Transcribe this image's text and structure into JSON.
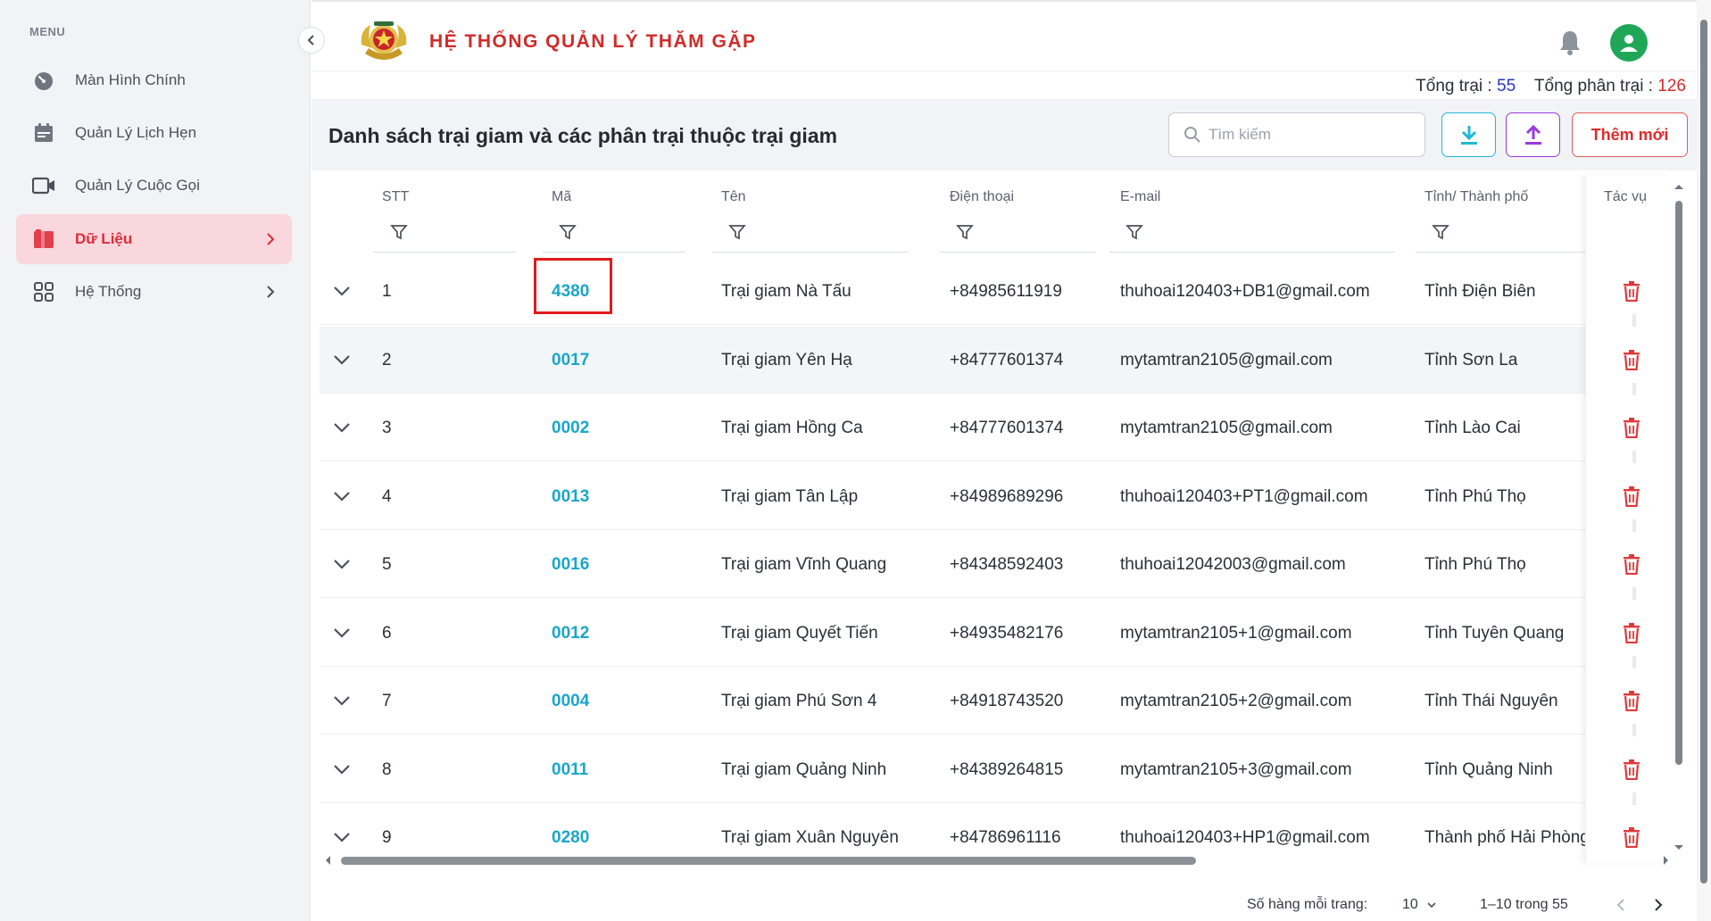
{
  "sidebar": {
    "menu_title": "MENU",
    "items": [
      {
        "label": "Màn Hình Chính",
        "icon": "dashboard-gauge-icon"
      },
      {
        "label": "Quản Lý Lịch Hẹn",
        "icon": "calendar-icon"
      },
      {
        "label": "Quản Lý Cuộc Gọi",
        "icon": "video-camera-icon"
      },
      {
        "label": "Dữ Liệu",
        "icon": "database-folder-icon",
        "active": true
      },
      {
        "label": "Hệ Thống",
        "icon": "grid-apps-icon"
      }
    ]
  },
  "header": {
    "title": "HỆ THỐNG QUẢN LÝ THĂM GẶP",
    "logo": "police-emblem-logo"
  },
  "totals": {
    "camps_label": "Tổng trại :",
    "camps_value": "55",
    "subcamps_label": "Tổng phân trại :",
    "subcamps_value": "126"
  },
  "toolbar": {
    "title": "Danh sách trại giam và các phân trại thuộc trại giam",
    "search_placeholder": "Tìm kiếm",
    "add_label": "Thêm mới"
  },
  "table": {
    "columns": [
      "STT",
      "Mã",
      "Tên",
      "Điện thoại",
      "E-mail",
      "Tỉnh/ Thành phố",
      "Tác vụ"
    ],
    "rows": [
      {
        "stt": "1",
        "code": "4380",
        "name": "Trại giam Nà Tấu",
        "phone": "+84985611919",
        "email": "thuhoai120403+DB1@gmail.com",
        "province": "Tỉnh Điện Biên"
      },
      {
        "stt": "2",
        "code": "0017",
        "name": "Trại giam Yên Hạ",
        "phone": "+84777601374",
        "email": "mytamtran2105@gmail.com",
        "province": "Tỉnh Sơn La"
      },
      {
        "stt": "3",
        "code": "0002",
        "name": "Trại giam Hồng Ca",
        "phone": "+84777601374",
        "email": "mytamtran2105@gmail.com",
        "province": "Tỉnh Lào Cai"
      },
      {
        "stt": "4",
        "code": "0013",
        "name": "Trại giam Tân Lập",
        "phone": "+84989689296",
        "email": "thuhoai120403+PT1@gmail.com",
        "province": "Tỉnh Phú Thọ"
      },
      {
        "stt": "5",
        "code": "0016",
        "name": "Trại giam Vĩnh Quang",
        "phone": "+84348592403",
        "email": "thuhoai12042003@gmail.com",
        "province": "Tỉnh Phú Thọ"
      },
      {
        "stt": "6",
        "code": "0012",
        "name": "Trại giam Quyết Tiến",
        "phone": "+84935482176",
        "email": "mytamtran2105+1@gmail.com",
        "province": "Tỉnh Tuyên Quang"
      },
      {
        "stt": "7",
        "code": "0004",
        "name": "Trại giam Phú Sơn 4",
        "phone": "+84918743520",
        "email": "mytamtran2105+2@gmail.com",
        "province": "Tỉnh Thái Nguyên"
      },
      {
        "stt": "8",
        "code": "0011",
        "name": "Trại giam Quảng Ninh",
        "phone": "+84389264815",
        "email": "mytamtran2105+3@gmail.com",
        "province": "Tỉnh Quảng Ninh"
      },
      {
        "stt": "9",
        "code": "0280",
        "name": "Trại giam Xuân Nguyên",
        "phone": "+84786961116",
        "email": "thuhoai120403+HP1@gmail.com",
        "province": "Thành phố Hải Phòng"
      }
    ]
  },
  "pagination": {
    "rows_per_page_label": "Số hàng mỗi trang:",
    "rows_per_page_value": "10",
    "range": "1–10 trong 55"
  },
  "colors": {
    "brand_red": "#d02b2b",
    "code_link": "#1aa6c9",
    "active_bg": "#f9d7dc",
    "download_accent": "#22b7d8",
    "upload_accent": "#9b3ae0",
    "avatar_green": "#1fa757"
  }
}
